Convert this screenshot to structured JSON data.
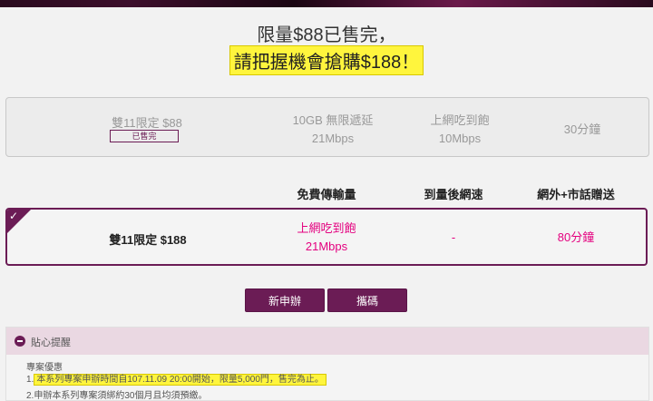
{
  "headline": {
    "line1": "限量$88已售完，",
    "line2": "請把握機會搶購$188！"
  },
  "sold_out_plan": {
    "name": "雙11限定 $88",
    "badge": "已售完",
    "col1_line1": "10GB 無限遞延",
    "col1_line2": "21Mbps",
    "col2_line1": "上網吃到飽",
    "col2_line2": "10Mbps",
    "col3": "30分鐘"
  },
  "columns": {
    "col1": "免費傳輸量",
    "col2": "到量後網速",
    "col3": "網外+市話贈送"
  },
  "selected_plan": {
    "check": "✓",
    "name": "雙11限定 $188",
    "col1_line1": "上網吃到飽",
    "col1_line2": "21Mbps",
    "col2": "-",
    "col3": "80分鐘"
  },
  "buttons": {
    "new_label": "新申辦",
    "transfer_label": "攜碼"
  },
  "notice": {
    "title": "貼心提醒",
    "heading": "專案優惠",
    "line1_prefix": "1.",
    "line1_highlight": "本系列專案申辦時間自107.11.09 20:00開始，限量5,000門，售完為止。",
    "line2": "2.申辦本系列專案須綁約30個月且均須預繳。"
  },
  "colors": {
    "brand": "#6b1c55",
    "accent": "#e4007f",
    "highlight": "#fff53d"
  }
}
